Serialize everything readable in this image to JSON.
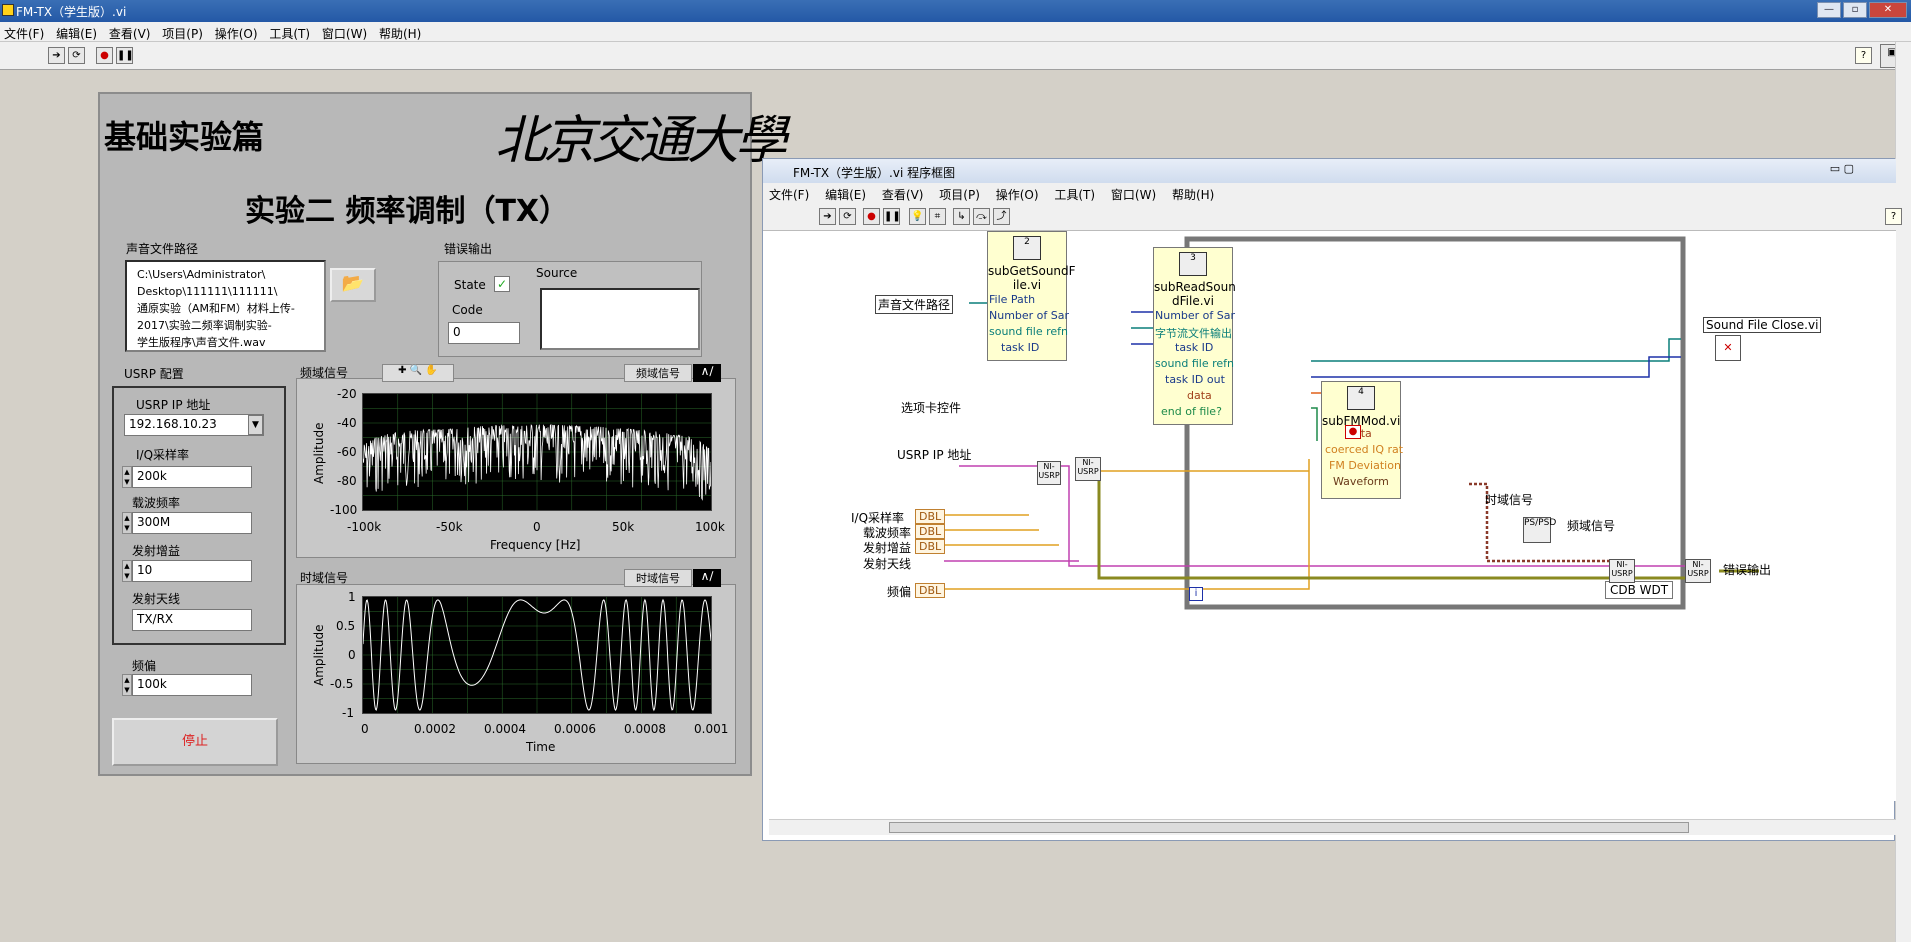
{
  "window": {
    "title": "FM-TX（学生版）.vi",
    "buttons": [
      "—",
      "▫",
      "✕"
    ]
  },
  "menu": [
    "文件(F)",
    "编辑(E)",
    "查看(V)",
    "项目(P)",
    "操作(O)",
    "工具(T)",
    "窗口(W)",
    "帮助(H)"
  ],
  "front": {
    "header": "基础实验篇",
    "logo": "北京交通大學",
    "exp_title": "实验二  频率调制（TX）",
    "file_path_label": "声音文件路径",
    "file_path_value": "C:\\Users\\Administrator\\\nDesktop\\111111\\111111\\\n通原实验（AM和FM）材料上传-\n2017\\实验二频率调制实验-\n学生版程序\\声音文件.wav",
    "error_label": "错误输出",
    "state_label": "State",
    "source_label": "Source",
    "code_label": "Code",
    "code_value": "0",
    "usrp_config_label": "USRP 配置",
    "usrp_ip_label": "USRP IP 地址",
    "usrp_ip_value": "192.168.10.23",
    "iq_rate_label": "I/Q采样率",
    "iq_rate_value": "200k",
    "carrier_label": "载波频率",
    "carrier_value": "300M",
    "gain_label": "发射增益",
    "gain_value": "10",
    "antenna_label": "发射天线",
    "antenna_value": "TX/RX",
    "deviation_label": "频偏",
    "deviation_value": "100k",
    "stop_label": "停止",
    "freq_graph": {
      "label": "频域信号",
      "legend": "频域信号",
      "xlabel": "Frequency [Hz]",
      "ylabel": "Amplitude",
      "xticks": [
        "-100k",
        "-50k",
        "0",
        "50k",
        "100k"
      ],
      "yticks": [
        "-20",
        "-40",
        "-60",
        "-80",
        "-100"
      ]
    },
    "time_graph": {
      "label": "时域信号",
      "legend": "时域信号",
      "xlabel": "Time",
      "ylabel": "Amplitude",
      "xticks": [
        "0",
        "0.0002",
        "0.0004",
        "0.0006",
        "0.0008",
        "0.001"
      ],
      "yticks": [
        "1",
        "0.5",
        "0",
        "-0.5",
        "-1"
      ]
    }
  },
  "chart_data": [
    {
      "type": "line",
      "ylabel": "Amplitude",
      "xlabel": "Frequency [Hz]",
      "xlim": [
        -100000,
        100000
      ],
      "ylim": [
        -100,
        -20
      ],
      "grid": true,
      "series": [
        {
          "name": "频域信号",
          "envelope_x": [
            -100000,
            -90000,
            -70000,
            -50000,
            -30000,
            0,
            30000,
            50000,
            70000,
            90000,
            100000
          ],
          "envelope_y": [
            -55,
            -48,
            -45,
            -44,
            -42,
            -41,
            -42,
            -44,
            -46,
            -50,
            -58
          ]
        }
      ]
    },
    {
      "type": "line",
      "ylabel": "Amplitude",
      "xlabel": "Time",
      "xlim": [
        0,
        0.001
      ],
      "ylim": [
        -1,
        1
      ],
      "grid": true,
      "series": [
        {
          "name": "时域信号",
          "note_freq_varying": true,
          "x": [
            0,
            5e-05,
            0.0001,
            0.00015,
            0.0002,
            0.00025,
            0.0003,
            0.00035,
            0.0004,
            0.00045,
            0.0005,
            0.00055,
            0.0006,
            0.00065,
            0.0007,
            0.00075,
            0.0008,
            0.00085,
            0.0009,
            0.00095,
            0.001
          ],
          "y": [
            0.1,
            -0.6,
            0.9,
            -0.3,
            -0.9,
            0.9,
            -0.4,
            -0.95,
            0.85,
            -0.9,
            0.7,
            -0.9,
            0.95,
            -0.8,
            0.6,
            -0.95,
            0.9,
            0.2,
            0.9,
            -0.3,
            0.95
          ]
        }
      ]
    }
  ],
  "bd": {
    "title": "FM-TX（学生版）.vi 程序框图",
    "sub1": {
      "name": "subGetSoundF\nile.vi",
      "num": "2",
      "terms": [
        "File Path",
        "Number of Sar",
        "sound file refn",
        "task ID"
      ]
    },
    "sub2": {
      "name": "subReadSoun\ndFile.vi",
      "num": "3",
      "terms": [
        "Number of Sar",
        "字节流文件输出",
        "task ID",
        "sound file refn",
        "task ID out",
        "data",
        "end of file?"
      ]
    },
    "sub3": {
      "name": "subFMMod.vi",
      "num": "4",
      "terms": [
        "data",
        "coerced IQ rat",
        "FM Deviation",
        "Waveform"
      ]
    },
    "close": "Sound File Close.vi",
    "labels": {
      "path": "声音文件路径",
      "tab": "选项卡控件",
      "usrp_ip": "USRP IP 地址",
      "iq": "I/Q采样率",
      "carrier": "载波频率",
      "gain": "发射增益",
      "antenna": "发射天线",
      "dev": "频偏",
      "time": "时域信号",
      "freq": "频域信号",
      "err": "错误输出",
      "cdb": "CDB WDT"
    }
  }
}
